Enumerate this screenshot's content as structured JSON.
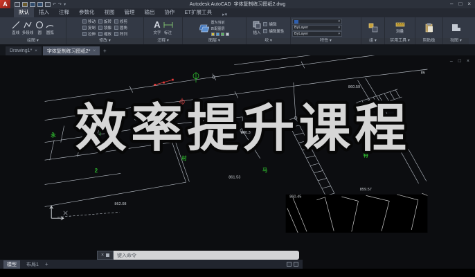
{
  "window": {
    "app_title": "Autodesk AutoCAD",
    "doc_title": "字体复制练习图纸2.dwg",
    "minimize": "–",
    "restore": "□",
    "close": "×",
    "quick_access_icons": [
      "app-menu",
      "new",
      "open",
      "save",
      "save-as",
      "plot",
      "undo",
      "redo"
    ],
    "undo_glyph": "↶",
    "redo_glyph": "↷",
    "dropdown_glyph": "▾",
    "logo_letter": "A"
  },
  "ribbon": {
    "tabs": [
      "默认",
      "插入",
      "注释",
      "参数化",
      "视图",
      "管理",
      "输出",
      "协作",
      "ET扩展工具"
    ],
    "active_tab": "默认",
    "overflow_glyph": "▸▾",
    "panel_labels": [
      "绘图 ▾",
      "修改 ▾",
      "注释 ▾",
      "图层 ▾",
      "块 ▾",
      "特性 ▾",
      "组 ▾",
      "实用工具 ▾",
      "剪贴板",
      "视图 ▾"
    ],
    "draw_tools": [
      "直线",
      "多段线",
      "圆",
      "圆弧"
    ],
    "modify_tools": [
      "移动",
      "旋转",
      "修剪",
      "复制",
      "镜像",
      "圆角",
      "拉伸",
      "缩放",
      "阵列"
    ],
    "annotation_tools": [
      "文字",
      "标注"
    ],
    "layer_tools": [
      "置为当前",
      "匹配图层"
    ],
    "block_tools": [
      "插入",
      "编辑",
      "编辑属性"
    ],
    "property_rows": [
      "ByLayer",
      "ByLayer"
    ],
    "utility_tools": [
      "测量"
    ]
  },
  "file_tabs": {
    "items": [
      "Drawing1*",
      "字体复制练习图纸2*"
    ],
    "close_glyph": "×",
    "add_glyph": "+"
  },
  "canvas": {
    "overlay_title": "效率提升课程",
    "doc_controls": "–  □  ×",
    "labels": [
      {
        "text": "862.08"
      },
      {
        "text": "860.59"
      },
      {
        "text": "860.3"
      },
      {
        "text": "861.53"
      },
      {
        "text": "859.57"
      },
      {
        "text": "860.45"
      },
      {
        "text": "862.08"
      },
      {
        "text": "86"
      }
    ],
    "green_labels": [
      {
        "text": "永"
      },
      {
        "text": "2"
      },
      {
        "text": "马"
      },
      {
        "text": "村"
      },
      {
        "text": "特"
      }
    ],
    "colors": {
      "line": "#b6bcc4",
      "text": "#c9cdd2",
      "green": "#2eb82e",
      "red": "#e23b3b",
      "overlay_fill": "#d6d6d6",
      "overlay_stroke": "#070707"
    }
  },
  "command_bar": {
    "prompt": "键入命令",
    "close_glyph": "×"
  },
  "status_bar": {
    "model_tab": "模型",
    "layout_tab": "布局1",
    "add_glyph": "+",
    "icons": [
      "grid",
      "annotation-scale"
    ]
  }
}
